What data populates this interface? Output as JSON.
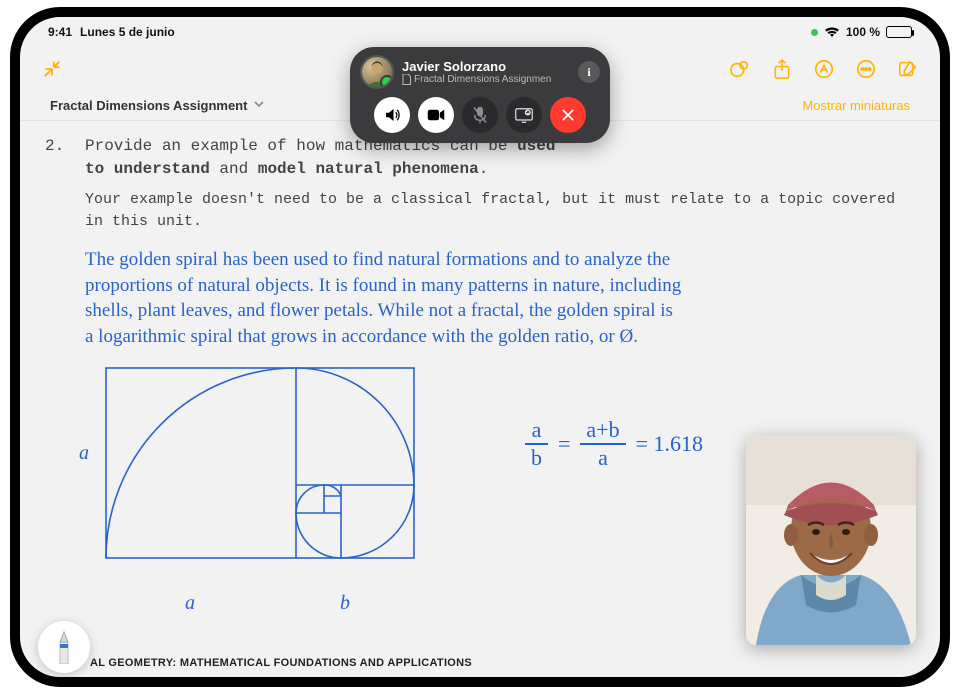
{
  "status": {
    "time": "9:41",
    "date": "Lunes 5 de junio",
    "battery_pct": "100 %",
    "wifi": "wifi"
  },
  "toolbar": {
    "collapse": "collapse",
    "magic": "magic",
    "share": "share",
    "markup_icon": "markup",
    "more": "more",
    "compose": "compose"
  },
  "note": {
    "title": "Fractal Dimensions Assignment",
    "show_thumbs": "Mostrar miniaturas"
  },
  "question": {
    "number": "2.",
    "prompt_a": "Provide an example of how mathematics can be ",
    "prompt_b1": "used",
    "prompt_c": " ",
    "prompt_b2": "to understand",
    "prompt_d": " and ",
    "prompt_b3": "model natural phenomena",
    "prompt_e": ".",
    "sub": "Your example doesn't need to be a classical fractal, but it must relate to a topic covered in this unit."
  },
  "handwriting": {
    "line1": "The golden spiral has been used to find natural formations and to analyze the",
    "line2": "proportions of natural objects. It is found in many patterns in nature, including",
    "line3": "shells, plant leaves, and flower petals. While not a fractal, the golden spiral is",
    "line4": "a logarithmic spiral that grows in accordance with the golden ratio, or Ø."
  },
  "labels": {
    "a_left": "a",
    "a_bottom": "a",
    "b_bottom": "b"
  },
  "equation": {
    "f1_top": "a",
    "f1_bot": "b",
    "eq1": "=",
    "f2_top": "a+b",
    "f2_bot": "a",
    "eq2": "= 1.618"
  },
  "footer": {
    "text": "AL GEOMETRY: MATHEMATICAL FOUNDATIONS AND APPLICATIONS"
  },
  "facetime": {
    "name": "Javier Solorzano",
    "doc_label": "Fractal Dimensions Assignmen",
    "info": "i",
    "buttons": {
      "speaker": "speaker",
      "camera": "camera",
      "mute": "mute",
      "screenshare": "screenshare",
      "end": "end"
    }
  },
  "colors": {
    "accent": "#ffb400",
    "ink": "#2963c7",
    "red": "#ff3b30",
    "green": "#34c759"
  }
}
